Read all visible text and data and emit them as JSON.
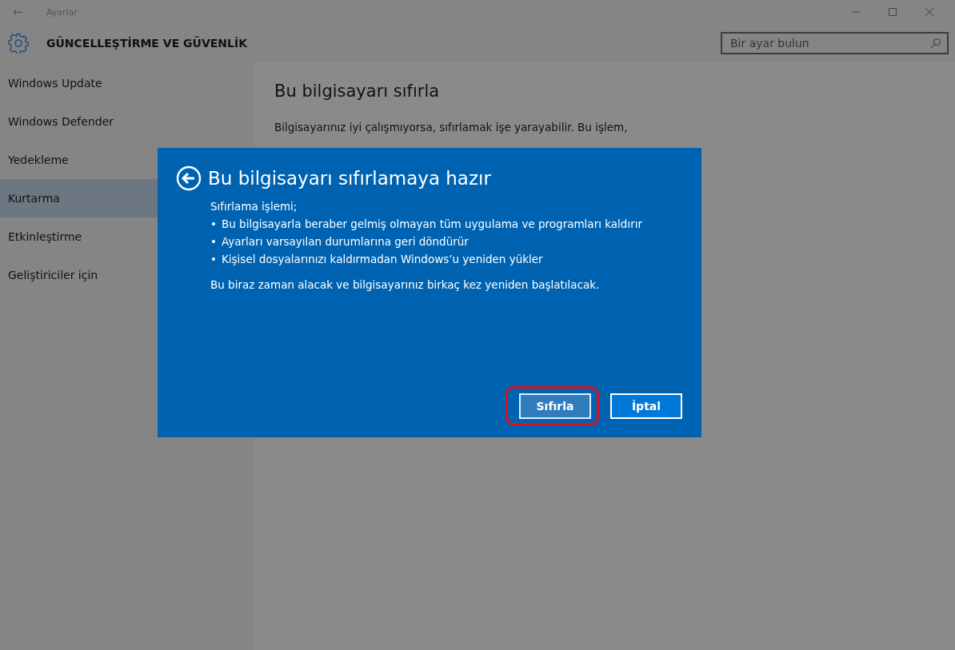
{
  "window": {
    "title": "Ayarlar",
    "back": "←"
  },
  "header": {
    "title": "GÜNCELLEŞTİRME VE GÜVENLİK"
  },
  "search": {
    "placeholder": "Bir ayar bulun"
  },
  "sidebar": {
    "items": [
      {
        "label": "Windows Update",
        "selected": false
      },
      {
        "label": "Windows Defender",
        "selected": false
      },
      {
        "label": "Yedekleme",
        "selected": false
      },
      {
        "label": "Kurtarma",
        "selected": true
      },
      {
        "label": "Etkinleştirme",
        "selected": false
      },
      {
        "label": "Geliştiriciler için",
        "selected": false
      }
    ]
  },
  "content": {
    "title": "Bu bilgisayarı sıfırla",
    "paragraph": [
      "Bilgisayarınız iyi çalışmıyorsa, sıfırlamak işe yarayabilir. Bu işlem,"
    ]
  },
  "dialog": {
    "title": "Bu bilgisayarı sıfırlamaya hazır",
    "intro": "Sıfırlama işlemi;",
    "bullets": [
      "Bu bilgisayarla beraber gelmiş olmayan tüm uygulama ve programları kaldırır",
      "Ayarları varsayılan durumlarına geri döndürür",
      "Kişisel dosyalarınızı kaldırmadan Windows’u yeniden yükler"
    ],
    "bullet_mark": "•",
    "note": "Bu biraz zaman alacak ve bilgisayarınız birkaç kez yeniden başlatılacak.",
    "buttons": [
      {
        "label": "Sıfırla",
        "highlighted": true
      },
      {
        "label": "İptal",
        "highlighted": false
      }
    ]
  }
}
